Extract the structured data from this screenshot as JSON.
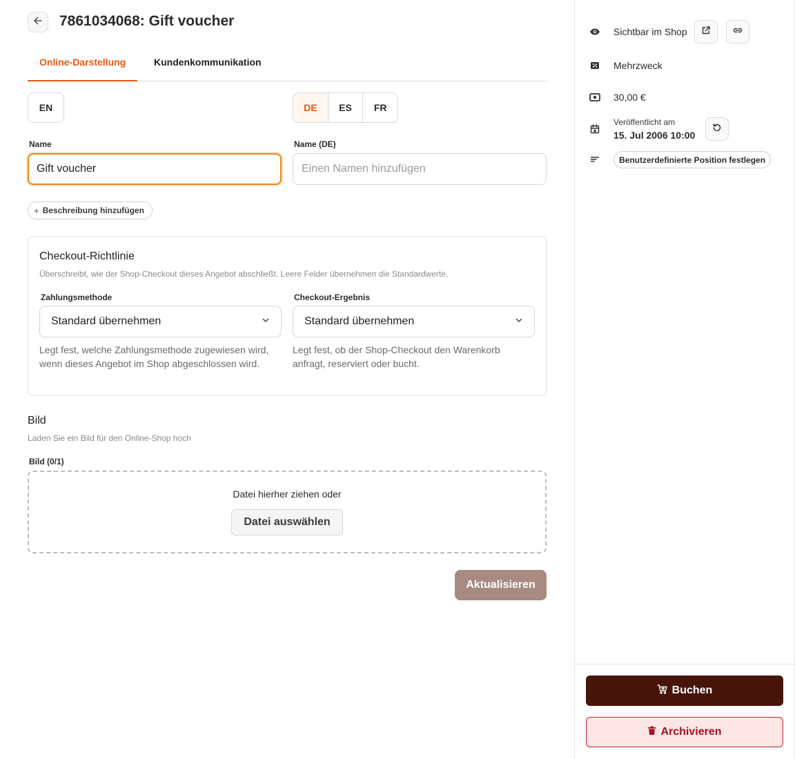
{
  "header": {
    "back_icon": "arrow-left-icon",
    "title": "7861034068: Gift voucher"
  },
  "tabs": [
    {
      "label": "Online-Darstellung",
      "active": true
    },
    {
      "label": "Kundenkommunikation",
      "active": false
    }
  ],
  "languages": {
    "left": "EN",
    "right": [
      "DE",
      "ES",
      "FR"
    ],
    "active": "DE",
    "accent_color": "#e8590c"
  },
  "name_fields": {
    "name_label": "Name",
    "name_value": "Gift voucher",
    "name_de_label": "Name (DE)",
    "name_de_placeholder": "Einen Namen hinzufügen"
  },
  "add_description": {
    "icon": "plus-icon",
    "label": "Beschreibung hinzufügen"
  },
  "checkout_policy": {
    "title": "Checkout-Richtlinie",
    "subtitle": "Überschreibt, wie der Shop-Checkout dieses Angebot abschließt. Leere Felder übernehmen die Standardwerte.",
    "payment": {
      "label": "Zahlungsmethode",
      "value": "Standard übernehmen",
      "help": "Legt fest, welche Zahlungsmethode zugewiesen wird, wenn dieses Angebot im Shop abgeschlossen wird."
    },
    "result": {
      "label": "Checkout-Ergebnis",
      "value": "Standard übernehmen",
      "help": "Legt fest, ob der Shop-Checkout den Warenkorb anfragt, reserviert oder bucht."
    }
  },
  "image": {
    "title": "Bild",
    "subtitle": "Laden Sie ein Bild für den Online-Shop hoch",
    "field_label": "Bild (0/1)",
    "drop_text": "Datei hierher ziehen oder",
    "choose_label": "Datei auswählen"
  },
  "update_label": "Aktualisieren",
  "sidebar": {
    "visibility": {
      "icon": "eye-icon",
      "label": "Sichtbar im Shop"
    },
    "type": {
      "icon": "voucher-icon",
      "label": "Mehrzweck"
    },
    "price": {
      "icon": "banknote-icon",
      "label": "30,00 €"
    },
    "published": {
      "icon": "calendar-icon",
      "label": "Veröffentlicht am",
      "date": "15. Jul 2006 10:00"
    },
    "position": {
      "icon": "sort-icon",
      "label": "Benutzerdefinierte Position festlegen"
    },
    "buy_label": "Buchen",
    "archive_label": "Archivieren",
    "buy_color": "#47140a",
    "archive_color": "#a5101c"
  }
}
